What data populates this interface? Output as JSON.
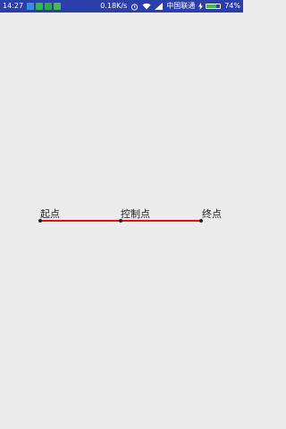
{
  "status_bar": {
    "time": "14:27",
    "net_speed": "0.18K/s",
    "carrier": "中国联通",
    "battery_percent": "74%",
    "battery_level": 0.74,
    "icons": [
      "notification-app-icon",
      "wechat-icon",
      "message-icon",
      "app-icon",
      "alarm-icon",
      "wifi-icon",
      "signal-icon",
      "charging-icon",
      "battery-icon"
    ]
  },
  "canvas": {
    "start_label": "起点",
    "control_label": "控制点",
    "end_label": "终点",
    "line_color": "#e01010"
  }
}
